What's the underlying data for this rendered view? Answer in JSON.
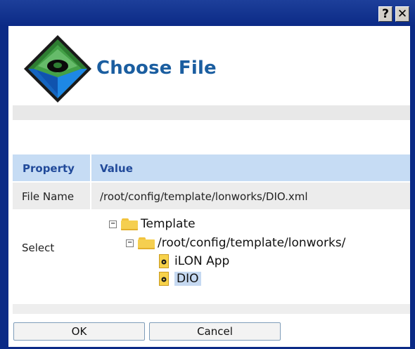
{
  "window": {
    "help_label": "?",
    "close_label": "✕",
    "frame_color": "#0b2a86"
  },
  "dialog": {
    "title": "Choose File",
    "logo_icon": "lonworks-diamond-icon"
  },
  "grid": {
    "headers": {
      "property": "Property",
      "value": "Value"
    },
    "file_name": {
      "label": "File Name",
      "value": "/root/config/template/lonworks/DIO.xml"
    },
    "select": {
      "label": "Select"
    }
  },
  "tree": {
    "root": {
      "label": "Template",
      "expander": "−"
    },
    "folder": {
      "label": "/root/config/template/lonworks/",
      "expander": "−"
    },
    "files": [
      {
        "label": "iLON App",
        "selected": false
      },
      {
        "label": "DIO",
        "selected": true
      }
    ]
  },
  "buttons": {
    "ok": "OK",
    "cancel": "Cancel"
  },
  "colors": {
    "header_bg": "#c6dcf4",
    "title_text": "#1b5ea0",
    "selection": "#c6d9f1"
  }
}
